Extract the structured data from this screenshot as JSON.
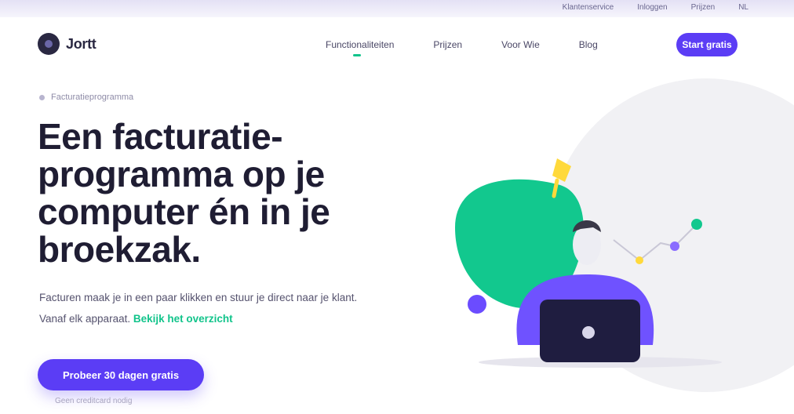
{
  "colors": {
    "accent": "#5b3df5",
    "green": "#12c48b",
    "ink": "#1f1d33"
  },
  "topbar": {
    "links": [
      "Klantenservice",
      "Inloggen",
      "Prijzen",
      "NL"
    ]
  },
  "brand": {
    "name": "Jortt",
    "logo_icon": "logo-icon"
  },
  "nav": {
    "items": [
      "Functionaliteiten",
      "Prijzen",
      "Voor Wie",
      "Blog"
    ],
    "active_index": 0,
    "cta": "Start gratis"
  },
  "hero": {
    "eyebrow": "Facturatieprogramma",
    "headline": "Een facturatie-programma op je computer én in je broekzak.",
    "sub_prefix": "Facturen maak je in een paar klikken en stuur je direct naar je klant. Vanaf elk apparaat.",
    "sub_link": "Bekijk het overzicht",
    "cta": "Probeer 30 dagen gratis",
    "note": "Geen creditcard nodig"
  }
}
